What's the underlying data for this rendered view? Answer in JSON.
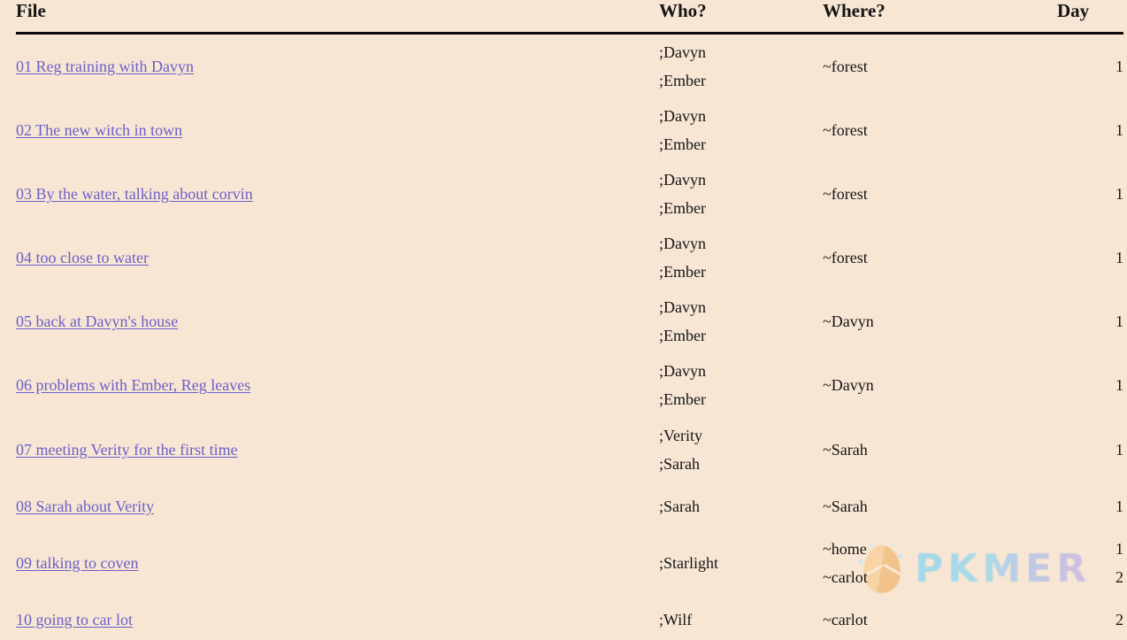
{
  "page": {
    "background_color": "#f7e6d4",
    "link_color": "#6b5fc7",
    "text_color": "#151515"
  },
  "table": {
    "columns": [
      {
        "key": "file",
        "label": "File"
      },
      {
        "key": "who",
        "label": "Who?"
      },
      {
        "key": "where",
        "label": "Where?"
      },
      {
        "key": "day",
        "label": "Day"
      }
    ],
    "rows": [
      {
        "file": "01 Reg training with Davyn",
        "who": [
          ";Davyn",
          ";Ember"
        ],
        "where": [
          "~forest"
        ],
        "day": [
          "1"
        ]
      },
      {
        "file": "02 The new witch in town",
        "who": [
          ";Davyn",
          ";Ember"
        ],
        "where": [
          "~forest"
        ],
        "day": [
          "1"
        ]
      },
      {
        "file": "03 By the water, talking about corvin",
        "who": [
          ";Davyn",
          ";Ember"
        ],
        "where": [
          "~forest"
        ],
        "day": [
          "1"
        ]
      },
      {
        "file": "04 too close to water",
        "who": [
          ";Davyn",
          ";Ember"
        ],
        "where": [
          "~forest"
        ],
        "day": [
          "1"
        ]
      },
      {
        "file": "05 back at Davyn's house",
        "who": [
          ";Davyn",
          ";Ember"
        ],
        "where": [
          "~Davyn"
        ],
        "day": [
          "1"
        ]
      },
      {
        "file": "06 problems with Ember, Reg leaves",
        "who": [
          ";Davyn",
          ";Ember"
        ],
        "where": [
          "~Davyn"
        ],
        "day": [
          "1"
        ]
      },
      {
        "file": "07 meeting Verity for the first time",
        "who": [
          ";Verity",
          ";Sarah"
        ],
        "where": [
          "~Sarah"
        ],
        "day": [
          "1"
        ]
      },
      {
        "file": "08 Sarah about Verity",
        "who": [
          ";Sarah"
        ],
        "where": [
          "~Sarah"
        ],
        "day": [
          "1"
        ]
      },
      {
        "file": "09 talking to coven",
        "who": [
          ";Starlight"
        ],
        "where": [
          "~home",
          "~carlot"
        ],
        "day": [
          "1",
          "2"
        ]
      },
      {
        "file": "10 going to car lot",
        "who": [
          ";Wilf"
        ],
        "where": [
          "~carlot"
        ],
        "day": [
          "2"
        ]
      }
    ]
  },
  "watermark": {
    "text": "PKMER",
    "logo_name": "pkmer-egg-logo",
    "color_start": "#84d5f2",
    "color_end": "#c3aeea"
  }
}
